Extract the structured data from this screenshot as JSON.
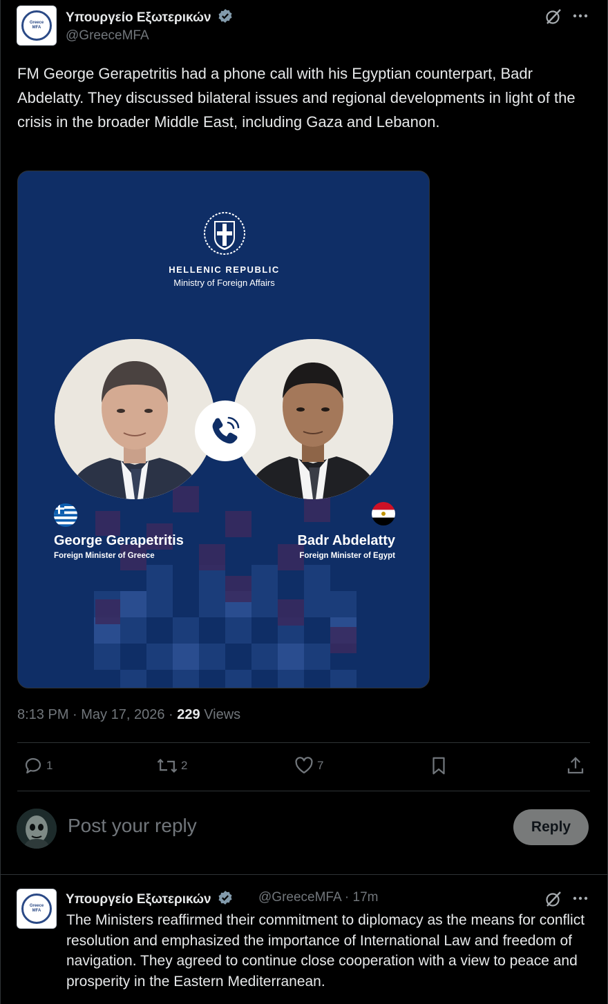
{
  "tweet": {
    "author_name": "Υπουργείο Εξωτερικών",
    "author_handle": "@GreeceMFA",
    "avatar_text": "Greece MFA",
    "text": "FM George Gerapetritis had a phone call with his Egyptian counterpart, Badr Abdelatty. They discussed bilateral issues and regional developments in light of the crisis in the broader Middle East, including Gaza and Lebanon.",
    "time": "8:13 PM",
    "date": "May 17, 2026",
    "views_count": "229",
    "views_label": "Views"
  },
  "card": {
    "heading": "HELLENIC REPUBLIC",
    "subheading": "Ministry of Foreign Affairs",
    "left_person": {
      "name": "George Gerapetritis",
      "role": "Foreign Minister of Greece"
    },
    "right_person": {
      "name": "Badr Abdelatty",
      "role": "Foreign Minister of Egypt"
    },
    "background_color": "#0f2e66"
  },
  "actions": {
    "replies": "1",
    "reposts": "2",
    "likes": "7"
  },
  "reply_box": {
    "placeholder": "Post your reply",
    "button": "Reply"
  },
  "thread_reply": {
    "author_name": "Υπουργείο Εξωτερικών",
    "author_handle": "@GreeceMFA",
    "time": "17m",
    "text": "The Ministers reaffirmed their commitment to diplomacy as the means for conflict resolution and emphasized the importance of International Law and freedom of navigation. They agreed to continue close cooperation with a view to peace and prosperity in the Eastern Mediterranean."
  },
  "icons": {
    "verified": "verified-badge-icon",
    "grok": "grok-icon",
    "more": "more-icon",
    "reply": "reply-icon",
    "repost": "repost-icon",
    "like": "heart-icon",
    "bookmark": "bookmark-icon",
    "share": "share-icon"
  },
  "colors": {
    "background": "#000000",
    "text": "#e7e9ea",
    "muted": "#71767b",
    "divider": "#2f3336"
  }
}
